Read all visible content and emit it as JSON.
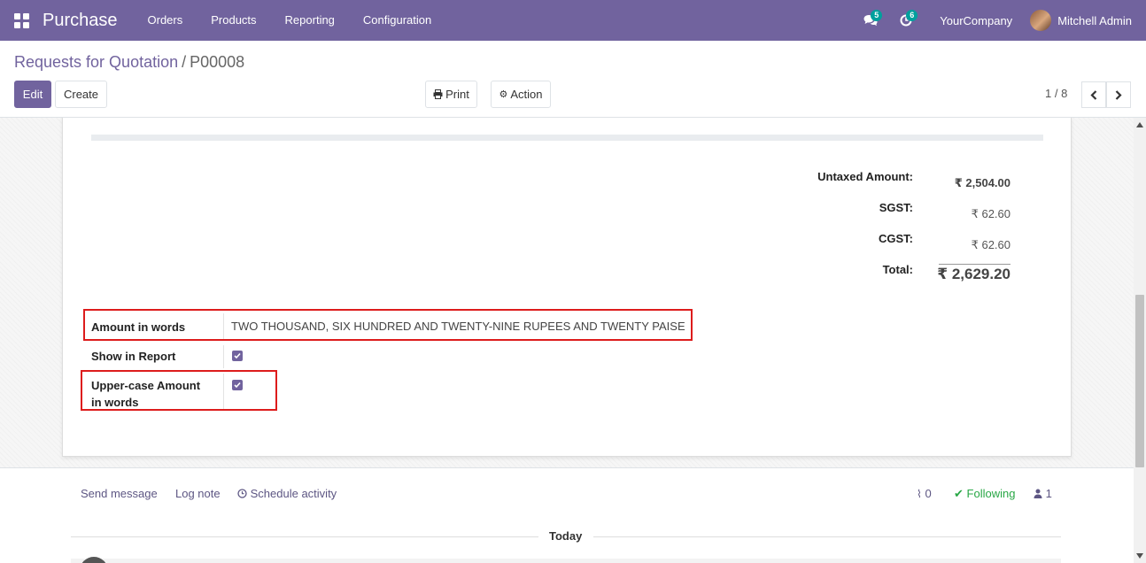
{
  "navbar": {
    "app_name": "Purchase",
    "menu": [
      "Orders",
      "Products",
      "Reporting",
      "Configuration"
    ],
    "messages_count": "5",
    "activities_count": "6",
    "company": "YourCompany",
    "user": "Mitchell Admin",
    "background_color": "#71639e"
  },
  "breadcrumb": {
    "parent": "Requests for Quotation",
    "separator": "/",
    "current": "P00008"
  },
  "buttons": {
    "edit": "Edit",
    "create": "Create",
    "print": "Print",
    "action": "Action"
  },
  "pager": {
    "value": "1 / 8"
  },
  "totals": {
    "untaxed_label": "Untaxed Amount:",
    "untaxed_value": "₹ 2,504.00",
    "sgst_label": "SGST:",
    "sgst_value": "₹ 62.60",
    "cgst_label": "CGST:",
    "cgst_value": "₹ 62.60",
    "total_label": "Total:",
    "total_value": "₹ 2,629.20"
  },
  "fields": {
    "amount_in_words_label": "Amount in words",
    "amount_in_words_value": "TWO THOUSAND, SIX HUNDRED AND TWENTY-NINE RUPEES AND TWENTY PAISE",
    "show_in_report_label": "Show in Report",
    "show_in_report_checked": true,
    "uppercase_label_line1": "Upper-case Amount",
    "uppercase_label_line2": "in words",
    "uppercase_checked": true
  },
  "chatter": {
    "send_message": "Send message",
    "log_note": "Log note",
    "schedule_activity": "Schedule activity",
    "attachments_count": "0",
    "following": "Following",
    "followers_count": "1",
    "date_separator": "Today"
  },
  "colors": {
    "accent": "#71639e",
    "highlight": "#dd1c1c",
    "following": "#28a745"
  }
}
